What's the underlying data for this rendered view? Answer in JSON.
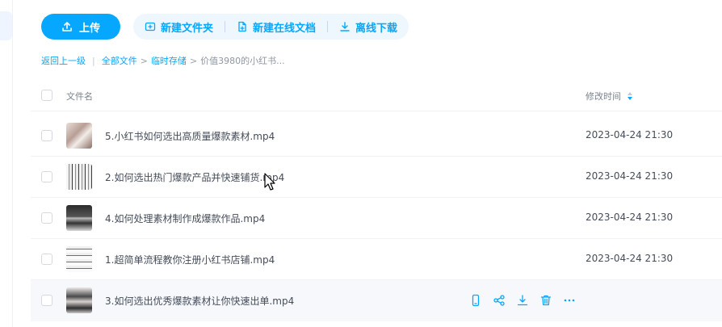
{
  "toolbar": {
    "upload_label": "上传",
    "new_folder_label": "新建文件夹",
    "new_online_doc_label": "新建在线文档",
    "offline_download_label": "离线下载"
  },
  "breadcrumb": {
    "back": "返回上一级",
    "separator": "|",
    "items": [
      "全部文件",
      "临时存储"
    ],
    "arrow": ">",
    "current": "价值3980的小红书..."
  },
  "table": {
    "columns": {
      "name": "文件名",
      "modified": "修改时间"
    },
    "rows": [
      {
        "name": "5.小红书如何选出高质量爆款素材.mp4",
        "modified": "2023-04-24 21:30"
      },
      {
        "name": "2.如何选出热门爆款产品并快速铺货.mp4",
        "modified": "2023-04-24 21:30"
      },
      {
        "name": "4.如何处理素材制作成爆款作品.mp4",
        "modified": "2023-04-24 21:30"
      },
      {
        "name": "1.超简单流程教你注册小红书店铺.mp4",
        "modified": "2023-04-24 21:30"
      },
      {
        "name": "3.如何选出优秀爆款素材让你快速出单.mp4",
        "modified": ""
      }
    ]
  },
  "icons": {
    "upload": "upload-icon",
    "new_folder": "folder-plus-icon",
    "new_doc": "doc-plus-icon",
    "download": "download-icon",
    "row_actions": [
      "phone-icon",
      "share-icon",
      "download-icon",
      "trash-icon",
      "more-icon"
    ]
  },
  "colors": {
    "accent": "#06a7ff",
    "text": "#454d5a",
    "muted": "#7a828e"
  }
}
